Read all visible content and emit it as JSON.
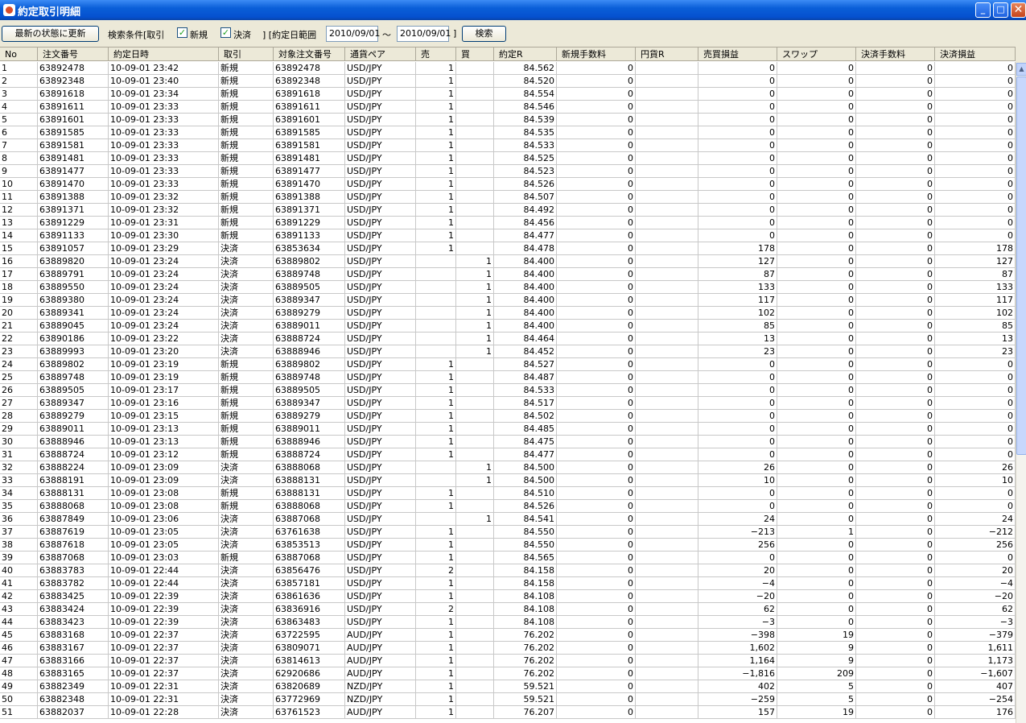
{
  "window": {
    "title": "約定取引明細",
    "minimize": "_",
    "maximize": "□",
    "close": "✕"
  },
  "toolbar": {
    "refresh_label": "最新の状態に更新",
    "condition_label": "検索条件[取引",
    "new_checked": true,
    "new_label": "新規",
    "settle_checked": true,
    "settle_label": "決済",
    "range_label": "]  [約定日範囲",
    "date_from": "2010/09/01",
    "tilde": "～",
    "date_to": "2010/09/01",
    "range_end": "]",
    "search_label": "検索"
  },
  "columns": [
    "No",
    "注文番号",
    "約定日時",
    "取引",
    "対象注文番号",
    "通貨ペア",
    "売",
    "買",
    "約定R",
    "新規手数料",
    "円貨R",
    "売買損益",
    "スワップ",
    "決済手数料",
    "決済損益"
  ],
  "rows": [
    [
      "1",
      "63892478",
      "10-09-01 23:42",
      "新規",
      "63892478",
      "USD/JPY",
      "1",
      "",
      "84.562",
      "0",
      "",
      "0",
      "0",
      "0",
      "0"
    ],
    [
      "2",
      "63892348",
      "10-09-01 23:40",
      "新規",
      "63892348",
      "USD/JPY",
      "1",
      "",
      "84.520",
      "0",
      "",
      "0",
      "0",
      "0",
      "0"
    ],
    [
      "3",
      "63891618",
      "10-09-01 23:34",
      "新規",
      "63891618",
      "USD/JPY",
      "1",
      "",
      "84.554",
      "0",
      "",
      "0",
      "0",
      "0",
      "0"
    ],
    [
      "4",
      "63891611",
      "10-09-01 23:33",
      "新規",
      "63891611",
      "USD/JPY",
      "1",
      "",
      "84.546",
      "0",
      "",
      "0",
      "0",
      "0",
      "0"
    ],
    [
      "5",
      "63891601",
      "10-09-01 23:33",
      "新規",
      "63891601",
      "USD/JPY",
      "1",
      "",
      "84.539",
      "0",
      "",
      "0",
      "0",
      "0",
      "0"
    ],
    [
      "6",
      "63891585",
      "10-09-01 23:33",
      "新規",
      "63891585",
      "USD/JPY",
      "1",
      "",
      "84.535",
      "0",
      "",
      "0",
      "0",
      "0",
      "0"
    ],
    [
      "7",
      "63891581",
      "10-09-01 23:33",
      "新規",
      "63891581",
      "USD/JPY",
      "1",
      "",
      "84.533",
      "0",
      "",
      "0",
      "0",
      "0",
      "0"
    ],
    [
      "8",
      "63891481",
      "10-09-01 23:33",
      "新規",
      "63891481",
      "USD/JPY",
      "1",
      "",
      "84.525",
      "0",
      "",
      "0",
      "0",
      "0",
      "0"
    ],
    [
      "9",
      "63891477",
      "10-09-01 23:33",
      "新規",
      "63891477",
      "USD/JPY",
      "1",
      "",
      "84.523",
      "0",
      "",
      "0",
      "0",
      "0",
      "0"
    ],
    [
      "10",
      "63891470",
      "10-09-01 23:33",
      "新規",
      "63891470",
      "USD/JPY",
      "1",
      "",
      "84.526",
      "0",
      "",
      "0",
      "0",
      "0",
      "0"
    ],
    [
      "11",
      "63891388",
      "10-09-01 23:32",
      "新規",
      "63891388",
      "USD/JPY",
      "1",
      "",
      "84.507",
      "0",
      "",
      "0",
      "0",
      "0",
      "0"
    ],
    [
      "12",
      "63891371",
      "10-09-01 23:32",
      "新規",
      "63891371",
      "USD/JPY",
      "1",
      "",
      "84.492",
      "0",
      "",
      "0",
      "0",
      "0",
      "0"
    ],
    [
      "13",
      "63891229",
      "10-09-01 23:31",
      "新規",
      "63891229",
      "USD/JPY",
      "1",
      "",
      "84.456",
      "0",
      "",
      "0",
      "0",
      "0",
      "0"
    ],
    [
      "14",
      "63891133",
      "10-09-01 23:30",
      "新規",
      "63891133",
      "USD/JPY",
      "1",
      "",
      "84.477",
      "0",
      "",
      "0",
      "0",
      "0",
      "0"
    ],
    [
      "15",
      "63891057",
      "10-09-01 23:29",
      "決済",
      "63853634",
      "USD/JPY",
      "1",
      "",
      "84.478",
      "0",
      "",
      "178",
      "0",
      "0",
      "178"
    ],
    [
      "16",
      "63889820",
      "10-09-01 23:24",
      "決済",
      "63889802",
      "USD/JPY",
      "",
      "1",
      "84.400",
      "0",
      "",
      "127",
      "0",
      "0",
      "127"
    ],
    [
      "17",
      "63889791",
      "10-09-01 23:24",
      "決済",
      "63889748",
      "USD/JPY",
      "",
      "1",
      "84.400",
      "0",
      "",
      "87",
      "0",
      "0",
      "87"
    ],
    [
      "18",
      "63889550",
      "10-09-01 23:24",
      "決済",
      "63889505",
      "USD/JPY",
      "",
      "1",
      "84.400",
      "0",
      "",
      "133",
      "0",
      "0",
      "133"
    ],
    [
      "19",
      "63889380",
      "10-09-01 23:24",
      "決済",
      "63889347",
      "USD/JPY",
      "",
      "1",
      "84.400",
      "0",
      "",
      "117",
      "0",
      "0",
      "117"
    ],
    [
      "20",
      "63889341",
      "10-09-01 23:24",
      "決済",
      "63889279",
      "USD/JPY",
      "",
      "1",
      "84.400",
      "0",
      "",
      "102",
      "0",
      "0",
      "102"
    ],
    [
      "21",
      "63889045",
      "10-09-01 23:24",
      "決済",
      "63889011",
      "USD/JPY",
      "",
      "1",
      "84.400",
      "0",
      "",
      "85",
      "0",
      "0",
      "85"
    ],
    [
      "22",
      "63890186",
      "10-09-01 23:22",
      "決済",
      "63888724",
      "USD/JPY",
      "",
      "1",
      "84.464",
      "0",
      "",
      "13",
      "0",
      "0",
      "13"
    ],
    [
      "23",
      "63889993",
      "10-09-01 23:20",
      "決済",
      "63888946",
      "USD/JPY",
      "",
      "1",
      "84.452",
      "0",
      "",
      "23",
      "0",
      "0",
      "23"
    ],
    [
      "24",
      "63889802",
      "10-09-01 23:19",
      "新規",
      "63889802",
      "USD/JPY",
      "1",
      "",
      "84.527",
      "0",
      "",
      "0",
      "0",
      "0",
      "0"
    ],
    [
      "25",
      "63889748",
      "10-09-01 23:19",
      "新規",
      "63889748",
      "USD/JPY",
      "1",
      "",
      "84.487",
      "0",
      "",
      "0",
      "0",
      "0",
      "0"
    ],
    [
      "26",
      "63889505",
      "10-09-01 23:17",
      "新規",
      "63889505",
      "USD/JPY",
      "1",
      "",
      "84.533",
      "0",
      "",
      "0",
      "0",
      "0",
      "0"
    ],
    [
      "27",
      "63889347",
      "10-09-01 23:16",
      "新規",
      "63889347",
      "USD/JPY",
      "1",
      "",
      "84.517",
      "0",
      "",
      "0",
      "0",
      "0",
      "0"
    ],
    [
      "28",
      "63889279",
      "10-09-01 23:15",
      "新規",
      "63889279",
      "USD/JPY",
      "1",
      "",
      "84.502",
      "0",
      "",
      "0",
      "0",
      "0",
      "0"
    ],
    [
      "29",
      "63889011",
      "10-09-01 23:13",
      "新規",
      "63889011",
      "USD/JPY",
      "1",
      "",
      "84.485",
      "0",
      "",
      "0",
      "0",
      "0",
      "0"
    ],
    [
      "30",
      "63888946",
      "10-09-01 23:13",
      "新規",
      "63888946",
      "USD/JPY",
      "1",
      "",
      "84.475",
      "0",
      "",
      "0",
      "0",
      "0",
      "0"
    ],
    [
      "31",
      "63888724",
      "10-09-01 23:12",
      "新規",
      "63888724",
      "USD/JPY",
      "1",
      "",
      "84.477",
      "0",
      "",
      "0",
      "0",
      "0",
      "0"
    ],
    [
      "32",
      "63888224",
      "10-09-01 23:09",
      "決済",
      "63888068",
      "USD/JPY",
      "",
      "1",
      "84.500",
      "0",
      "",
      "26",
      "0",
      "0",
      "26"
    ],
    [
      "33",
      "63888191",
      "10-09-01 23:09",
      "決済",
      "63888131",
      "USD/JPY",
      "",
      "1",
      "84.500",
      "0",
      "",
      "10",
      "0",
      "0",
      "10"
    ],
    [
      "34",
      "63888131",
      "10-09-01 23:08",
      "新規",
      "63888131",
      "USD/JPY",
      "1",
      "",
      "84.510",
      "0",
      "",
      "0",
      "0",
      "0",
      "0"
    ],
    [
      "35",
      "63888068",
      "10-09-01 23:08",
      "新規",
      "63888068",
      "USD/JPY",
      "1",
      "",
      "84.526",
      "0",
      "",
      "0",
      "0",
      "0",
      "0"
    ],
    [
      "36",
      "63887849",
      "10-09-01 23:06",
      "決済",
      "63887068",
      "USD/JPY",
      "",
      "1",
      "84.541",
      "0",
      "",
      "24",
      "0",
      "0",
      "24"
    ],
    [
      "37",
      "63887619",
      "10-09-01 23:05",
      "決済",
      "63761638",
      "USD/JPY",
      "1",
      "",
      "84.550",
      "0",
      "",
      "−213",
      "1",
      "0",
      "−212"
    ],
    [
      "38",
      "63887618",
      "10-09-01 23:05",
      "決済",
      "63853513",
      "USD/JPY",
      "1",
      "",
      "84.550",
      "0",
      "",
      "256",
      "0",
      "0",
      "256"
    ],
    [
      "39",
      "63887068",
      "10-09-01 23:03",
      "新規",
      "63887068",
      "USD/JPY",
      "1",
      "",
      "84.565",
      "0",
      "",
      "0",
      "0",
      "0",
      "0"
    ],
    [
      "40",
      "63883783",
      "10-09-01 22:44",
      "決済",
      "63856476",
      "USD/JPY",
      "2",
      "",
      "84.158",
      "0",
      "",
      "20",
      "0",
      "0",
      "20"
    ],
    [
      "41",
      "63883782",
      "10-09-01 22:44",
      "決済",
      "63857181",
      "USD/JPY",
      "1",
      "",
      "84.158",
      "0",
      "",
      "−4",
      "0",
      "0",
      "−4"
    ],
    [
      "42",
      "63883425",
      "10-09-01 22:39",
      "決済",
      "63861636",
      "USD/JPY",
      "1",
      "",
      "84.108",
      "0",
      "",
      "−20",
      "0",
      "0",
      "−20"
    ],
    [
      "43",
      "63883424",
      "10-09-01 22:39",
      "決済",
      "63836916",
      "USD/JPY",
      "2",
      "",
      "84.108",
      "0",
      "",
      "62",
      "0",
      "0",
      "62"
    ],
    [
      "44",
      "63883423",
      "10-09-01 22:39",
      "決済",
      "63863483",
      "USD/JPY",
      "1",
      "",
      "84.108",
      "0",
      "",
      "−3",
      "0",
      "0",
      "−3"
    ],
    [
      "45",
      "63883168",
      "10-09-01 22:37",
      "決済",
      "63722595",
      "AUD/JPY",
      "1",
      "",
      "76.202",
      "0",
      "",
      "−398",
      "19",
      "0",
      "−379"
    ],
    [
      "46",
      "63883167",
      "10-09-01 22:37",
      "決済",
      "63809071",
      "AUD/JPY",
      "1",
      "",
      "76.202",
      "0",
      "",
      "1,602",
      "9",
      "0",
      "1,611"
    ],
    [
      "47",
      "63883166",
      "10-09-01 22:37",
      "決済",
      "63814613",
      "AUD/JPY",
      "1",
      "",
      "76.202",
      "0",
      "",
      "1,164",
      "9",
      "0",
      "1,173"
    ],
    [
      "48",
      "63883165",
      "10-09-01 22:37",
      "決済",
      "62920686",
      "AUD/JPY",
      "1",
      "",
      "76.202",
      "0",
      "",
      "−1,816",
      "209",
      "0",
      "−1,607"
    ],
    [
      "49",
      "63882349",
      "10-09-01 22:31",
      "決済",
      "63820689",
      "NZD/JPY",
      "1",
      "",
      "59.521",
      "0",
      "",
      "402",
      "5",
      "0",
      "407"
    ],
    [
      "50",
      "63882348",
      "10-09-01 22:31",
      "決済",
      "63772969",
      "NZD/JPY",
      "1",
      "",
      "59.521",
      "0",
      "",
      "−259",
      "5",
      "0",
      "−254"
    ],
    [
      "51",
      "63882037",
      "10-09-01 22:28",
      "決済",
      "63761523",
      "AUD/JPY",
      "1",
      "",
      "76.207",
      "0",
      "",
      "157",
      "19",
      "0",
      "176"
    ]
  ],
  "scrollbar": {
    "up_arrow": "▲"
  }
}
